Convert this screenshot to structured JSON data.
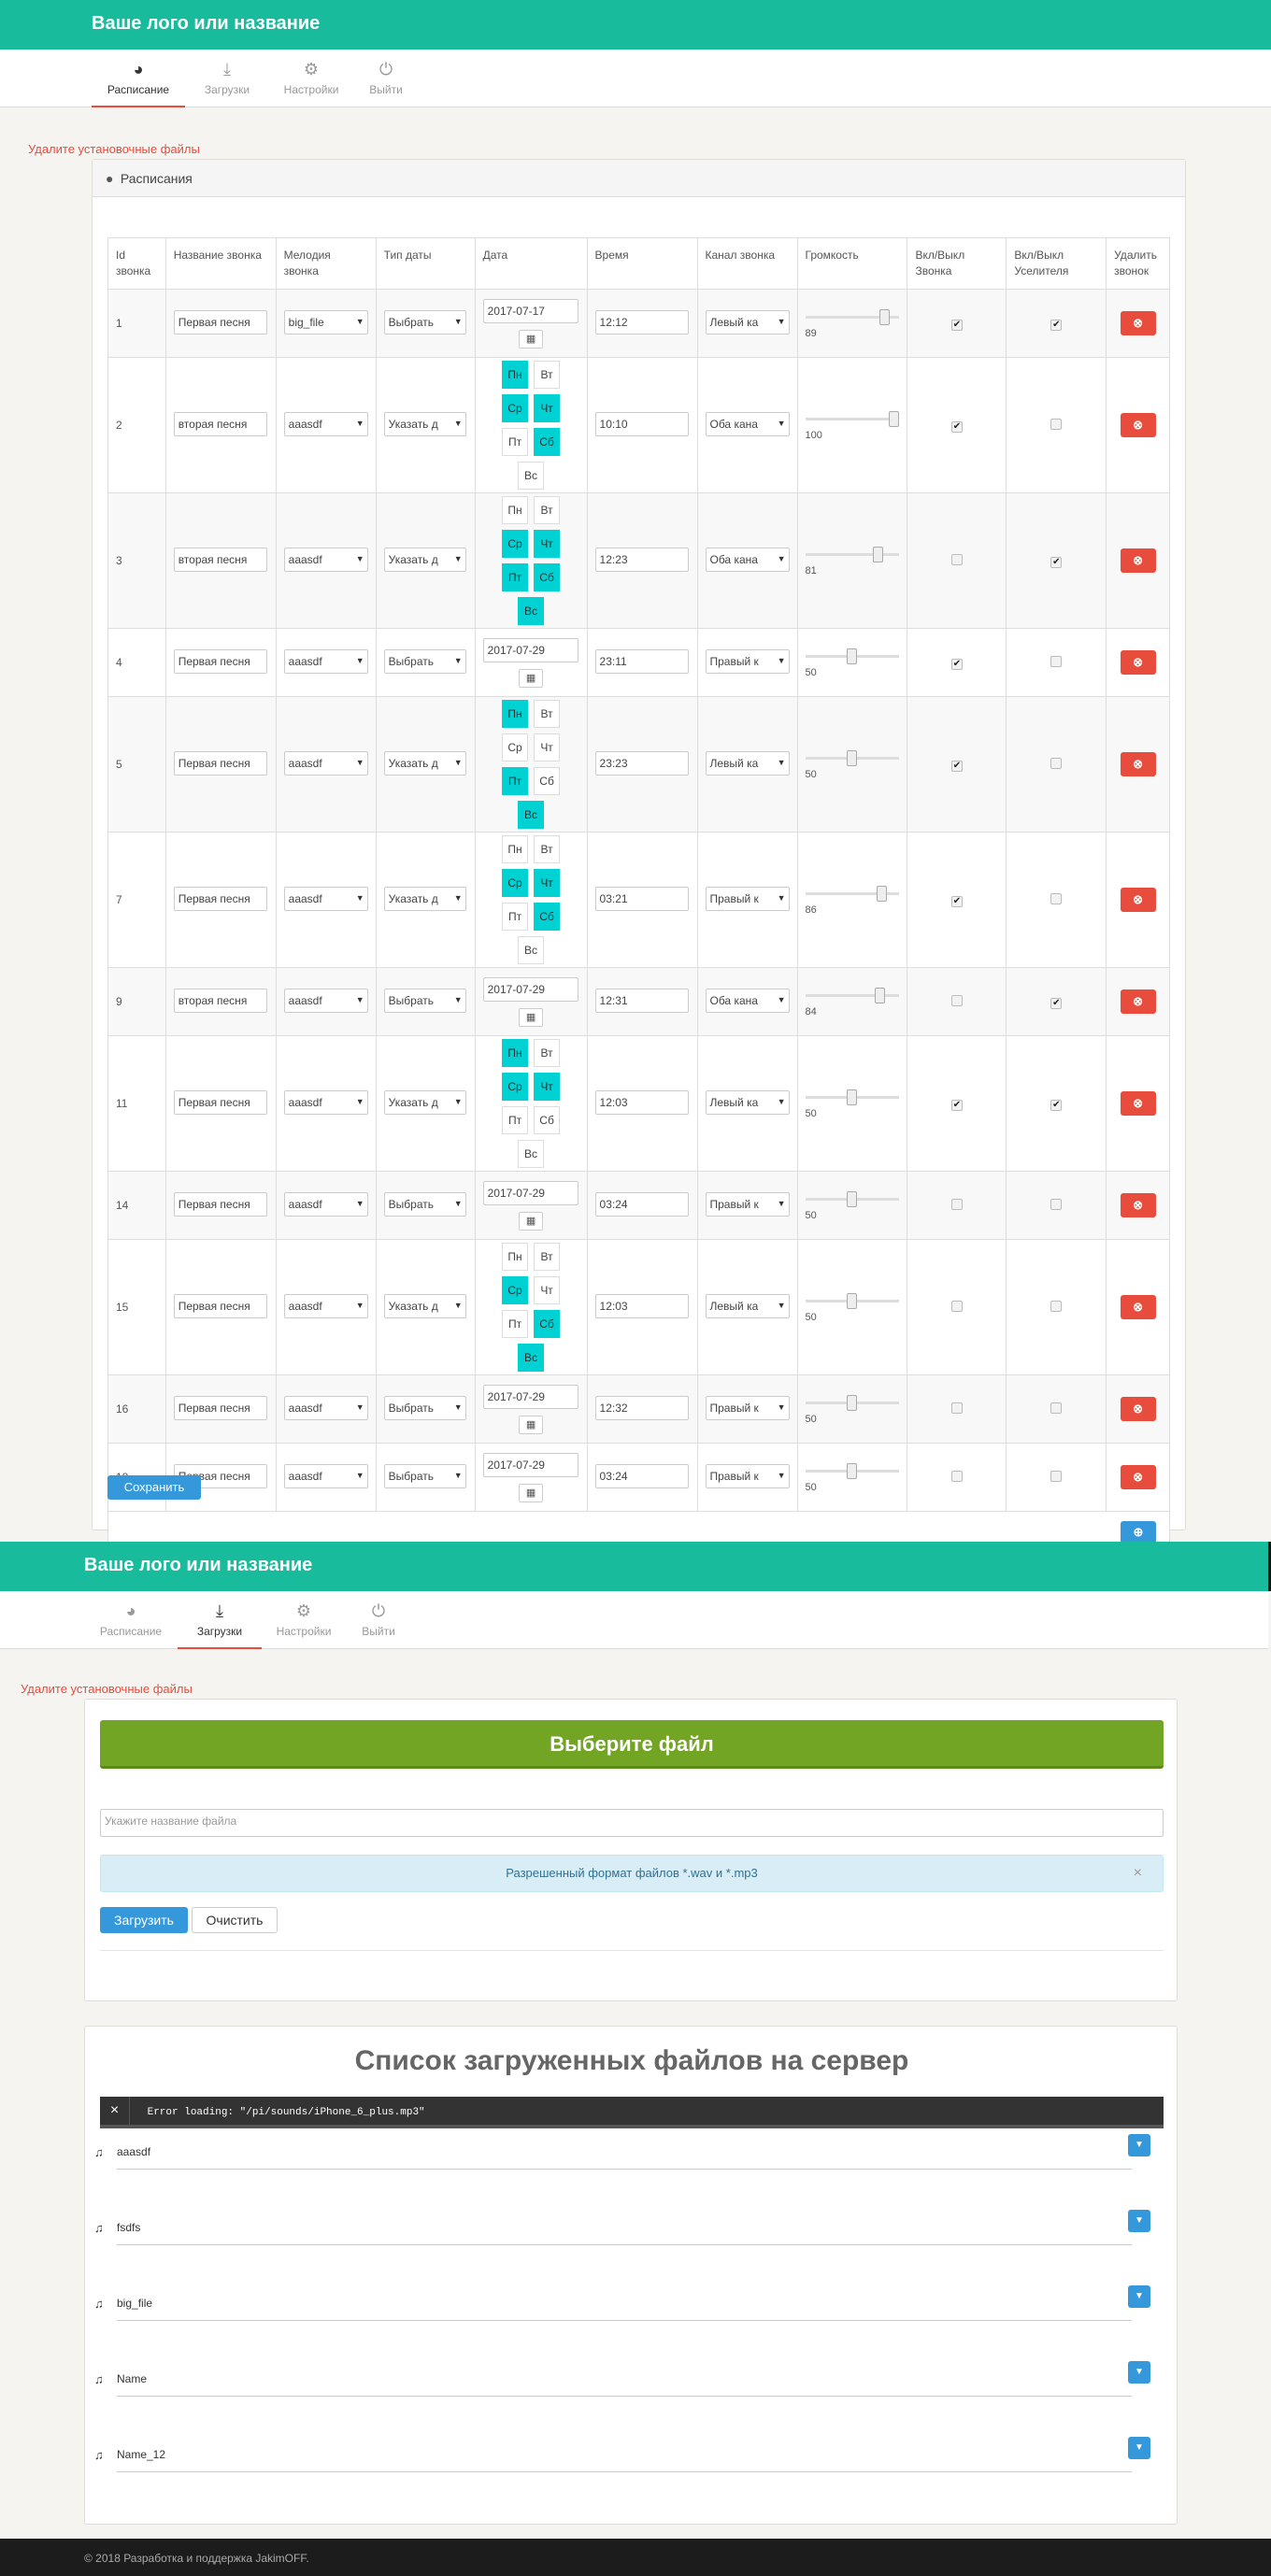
{
  "brand": "Ваше лого или название",
  "nav": [
    {
      "label": "Расписание",
      "icon": "dashboard-icon"
    },
    {
      "label": "Загрузки",
      "icon": "download-icon"
    },
    {
      "label": "Настройки",
      "icon": "gears-icon"
    },
    {
      "label": "Выйти",
      "icon": "power-icon"
    }
  ],
  "warning": "Удалите установочные файлы",
  "schedule": {
    "panel_title": "Расписания",
    "headers": [
      "Id звонка",
      "Название звонка",
      "Мелодия звонка",
      "Тип даты",
      "Дата",
      "Время",
      "Канал звонка",
      "Громкость",
      "Вкл/Выкл Звонка",
      "Вкл/Выкл Уселителя",
      "Удалить звонок"
    ],
    "day_labels": [
      "Пн",
      "Вт",
      "Ср",
      "Чт",
      "Пт",
      "Сб",
      "Вс"
    ],
    "calendar_icon": "calendar-icon",
    "rows": [
      {
        "id": "1",
        "name": "Первая песня",
        "melody": "big_file",
        "date_type": "Выбрать",
        "date": "2017-07-17",
        "days": null,
        "time": "12:12",
        "channel": "Левый ка",
        "volume": 89,
        "bell": true,
        "amp": true
      },
      {
        "id": "2",
        "name": "вторая песня",
        "melody": "aaasdf",
        "date_type": "Указать д",
        "date": null,
        "days": [
          true,
          false,
          true,
          true,
          false,
          true,
          false
        ],
        "time": "10:10",
        "channel": "Оба кана",
        "volume": 100,
        "bell": true,
        "amp": false
      },
      {
        "id": "3",
        "name": "вторая песня",
        "melody": "aaasdf",
        "date_type": "Указать д",
        "date": null,
        "days": [
          false,
          false,
          true,
          true,
          true,
          true,
          true
        ],
        "time": "12:23",
        "channel": "Оба кана",
        "volume": 81,
        "bell": false,
        "amp": true
      },
      {
        "id": "4",
        "name": "Первая песня",
        "melody": "aaasdf",
        "date_type": "Выбрать",
        "date": "2017-07-29",
        "days": null,
        "time": "23:11",
        "channel": "Правый к",
        "volume": 50,
        "bell": true,
        "amp": false
      },
      {
        "id": "5",
        "name": "Первая песня",
        "melody": "aaasdf",
        "date_type": "Указать д",
        "date": null,
        "days": [
          true,
          false,
          false,
          false,
          true,
          false,
          true
        ],
        "time": "23:23",
        "channel": "Левый ка",
        "volume": 50,
        "bell": true,
        "amp": false
      },
      {
        "id": "7",
        "name": "Первая песня",
        "melody": "aaasdf",
        "date_type": "Указать д",
        "date": null,
        "days": [
          false,
          false,
          true,
          true,
          false,
          true,
          false
        ],
        "time": "03:21",
        "channel": "Правый к",
        "volume": 86,
        "bell": true,
        "amp": false
      },
      {
        "id": "9",
        "name": "вторая песня",
        "melody": "aaasdf",
        "date_type": "Выбрать",
        "date": "2017-07-29",
        "days": null,
        "time": "12:31",
        "channel": "Оба кана",
        "volume": 84,
        "bell": false,
        "amp": true
      },
      {
        "id": "11",
        "name": "Первая песня",
        "melody": "aaasdf",
        "date_type": "Указать д",
        "date": null,
        "days": [
          true,
          false,
          true,
          true,
          false,
          false,
          false
        ],
        "time": "12:03",
        "channel": "Левый ка",
        "volume": 50,
        "bell": true,
        "amp": true
      },
      {
        "id": "14",
        "name": "Первая песня",
        "melody": "aaasdf",
        "date_type": "Выбрать",
        "date": "2017-07-29",
        "days": null,
        "time": "03:24",
        "channel": "Правый к",
        "volume": 50,
        "bell": false,
        "amp": false
      },
      {
        "id": "15",
        "name": "Первая песня",
        "melody": "aaasdf",
        "date_type": "Указать д",
        "date": null,
        "days": [
          false,
          false,
          true,
          false,
          false,
          true,
          true
        ],
        "time": "12:03",
        "channel": "Левый ка",
        "volume": 50,
        "bell": false,
        "amp": false
      },
      {
        "id": "16",
        "name": "Первая песня",
        "melody": "aaasdf",
        "date_type": "Выбрать",
        "date": "2017-07-29",
        "days": null,
        "time": "12:32",
        "channel": "Правый к",
        "volume": 50,
        "bell": false,
        "amp": false
      },
      {
        "id": "18",
        "name": "Первая песня",
        "melody": "aaasdf",
        "date_type": "Выбрать",
        "date": "2017-07-29",
        "days": null,
        "time": "03:24",
        "channel": "Правый к",
        "volume": 50,
        "bell": false,
        "amp": false
      }
    ],
    "save_label": "Сохранить",
    "delete_glyph": "⊗",
    "add_glyph": "⊕"
  },
  "upload": {
    "choose_label": "Выберите файл",
    "name_placeholder": "Укажите название файла",
    "info_text": "Разрешенный формат файлов *.wav и *.mp3",
    "close_glyph": "×",
    "upload_label": "Загрузить",
    "clear_label": "Очистить"
  },
  "files": {
    "title": "Список загруженных файлов на сервер",
    "error_text": "Error loading: \"/pi/sounds/iPhone_6_plus.mp3\"",
    "error_close": "×",
    "items": [
      "aaasdf",
      "fsdfs",
      "big_file",
      "Name",
      "Name_12"
    ]
  },
  "footer": "© 2018 Разработка и поддержка JakimOFF."
}
